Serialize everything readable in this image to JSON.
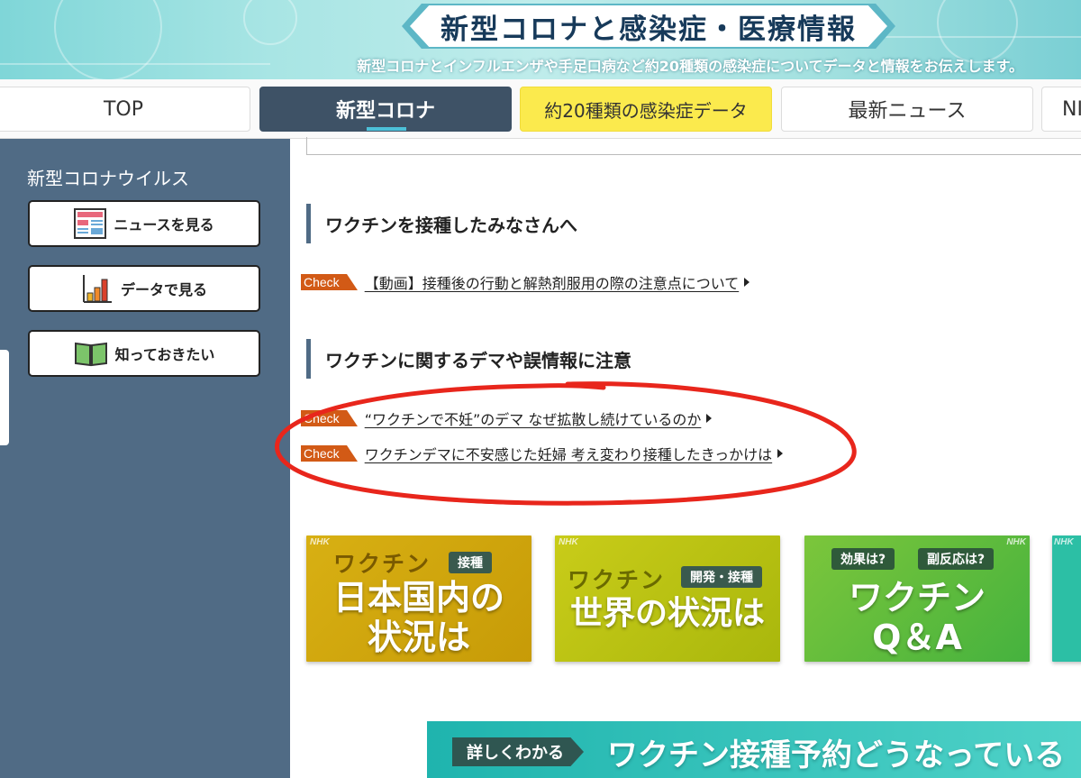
{
  "header": {
    "title": "新型コロナと感染症・医療情報",
    "subtitle": "新型コロナとインフルエンザや手足口病など約20種類の感染症についてデータと情報をお伝えします。"
  },
  "nav": {
    "tabs": [
      {
        "label": "TOP"
      },
      {
        "label": "新型コロナ"
      },
      {
        "label": "約20種類の感染症データ"
      },
      {
        "label": "最新ニュース"
      },
      {
        "label": "NI"
      }
    ]
  },
  "sidebar": {
    "title": "新型コロナウイルス",
    "buttons": [
      {
        "label": "ニュースを見る",
        "icon": "newspaper-icon"
      },
      {
        "label": "データで見る",
        "icon": "bar-chart-icon"
      },
      {
        "label": "知っておきたい",
        "icon": "book-icon"
      }
    ]
  },
  "main": {
    "sections": [
      {
        "heading": "ワクチンを接種したみなさんへ",
        "links": [
          {
            "badge": "Check",
            "text": "【動画】接種後の行動と解熱剤服用の際の注意点について"
          }
        ]
      },
      {
        "heading": "ワクチンに関するデマや誤情報に注意",
        "links": [
          {
            "badge": "Check",
            "text": "“ワクチンで不妊”のデマ なぜ拡散し続けているのか"
          },
          {
            "badge": "Check",
            "text": "ワクチンデマに不安感じた妊婦 考え変わり接種したきっかけは"
          }
        ]
      }
    ],
    "cards": [
      {
        "brand": "NHK",
        "head": "ワクチン",
        "pill": "接種",
        "big_line1": "日本国内の",
        "big_line2": "状況は"
      },
      {
        "brand": "NHK",
        "head": "ワクチン",
        "pill": "開発・接種",
        "big_line1": "世界の状況は"
      },
      {
        "brand": "NHK",
        "pill_left": "効果は?",
        "pill_right": "副反応は?",
        "big_line1": "ワクチン",
        "big_line2": "Q＆A"
      },
      {
        "brand": "NHK"
      }
    ],
    "bottom_banner": {
      "tag": "詳しくわかる",
      "headline": "ワクチン接種予約どうなっている"
    }
  },
  "colors": {
    "sidebar_bg": "#506b85",
    "active_tab": "#3e5266",
    "yellow_tab": "#fbea4d",
    "check_badge": "#d25a16",
    "annotation": "#e8261c"
  }
}
